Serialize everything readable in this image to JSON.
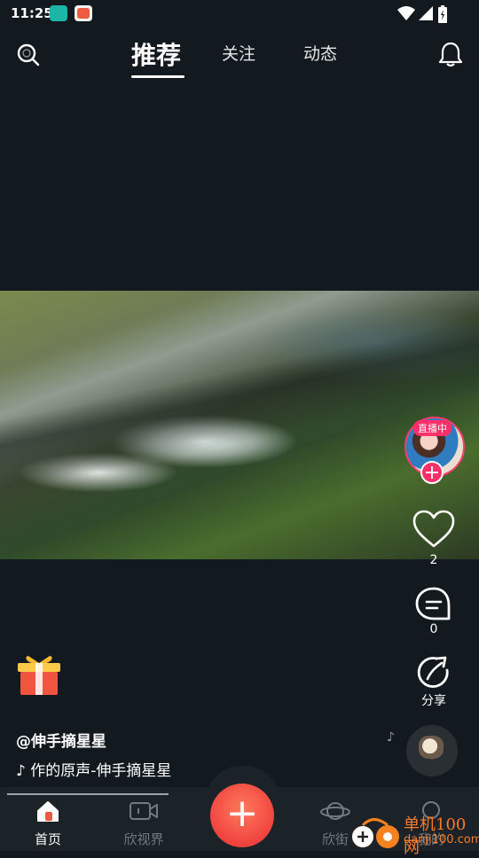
{
  "status_bar": {
    "time": "11:25"
  },
  "top_nav": {
    "tabs": [
      {
        "label": "推荐",
        "active": true
      },
      {
        "label": "关注",
        "active": false
      },
      {
        "label": "动态",
        "active": false
      }
    ]
  },
  "video": {
    "author": "@伸手摘星星",
    "music": "作的原声-伸手摘星星",
    "live_badge": "直播中"
  },
  "actions": {
    "likes": "2",
    "comments": "0",
    "share_label": "分享"
  },
  "bottom_nav": {
    "items": [
      {
        "label": "首页",
        "active": true
      },
      {
        "label": "欣视界",
        "active": false
      },
      {
        "label": "欣街",
        "active": false
      },
      {
        "label": "我的",
        "active": false
      }
    ]
  },
  "watermark": {
    "cn": "单机100网",
    "en": "danji100.com"
  },
  "colors": {
    "accent": "#ff2f6a",
    "create_button": "#f0433f",
    "background": "#121a20"
  }
}
